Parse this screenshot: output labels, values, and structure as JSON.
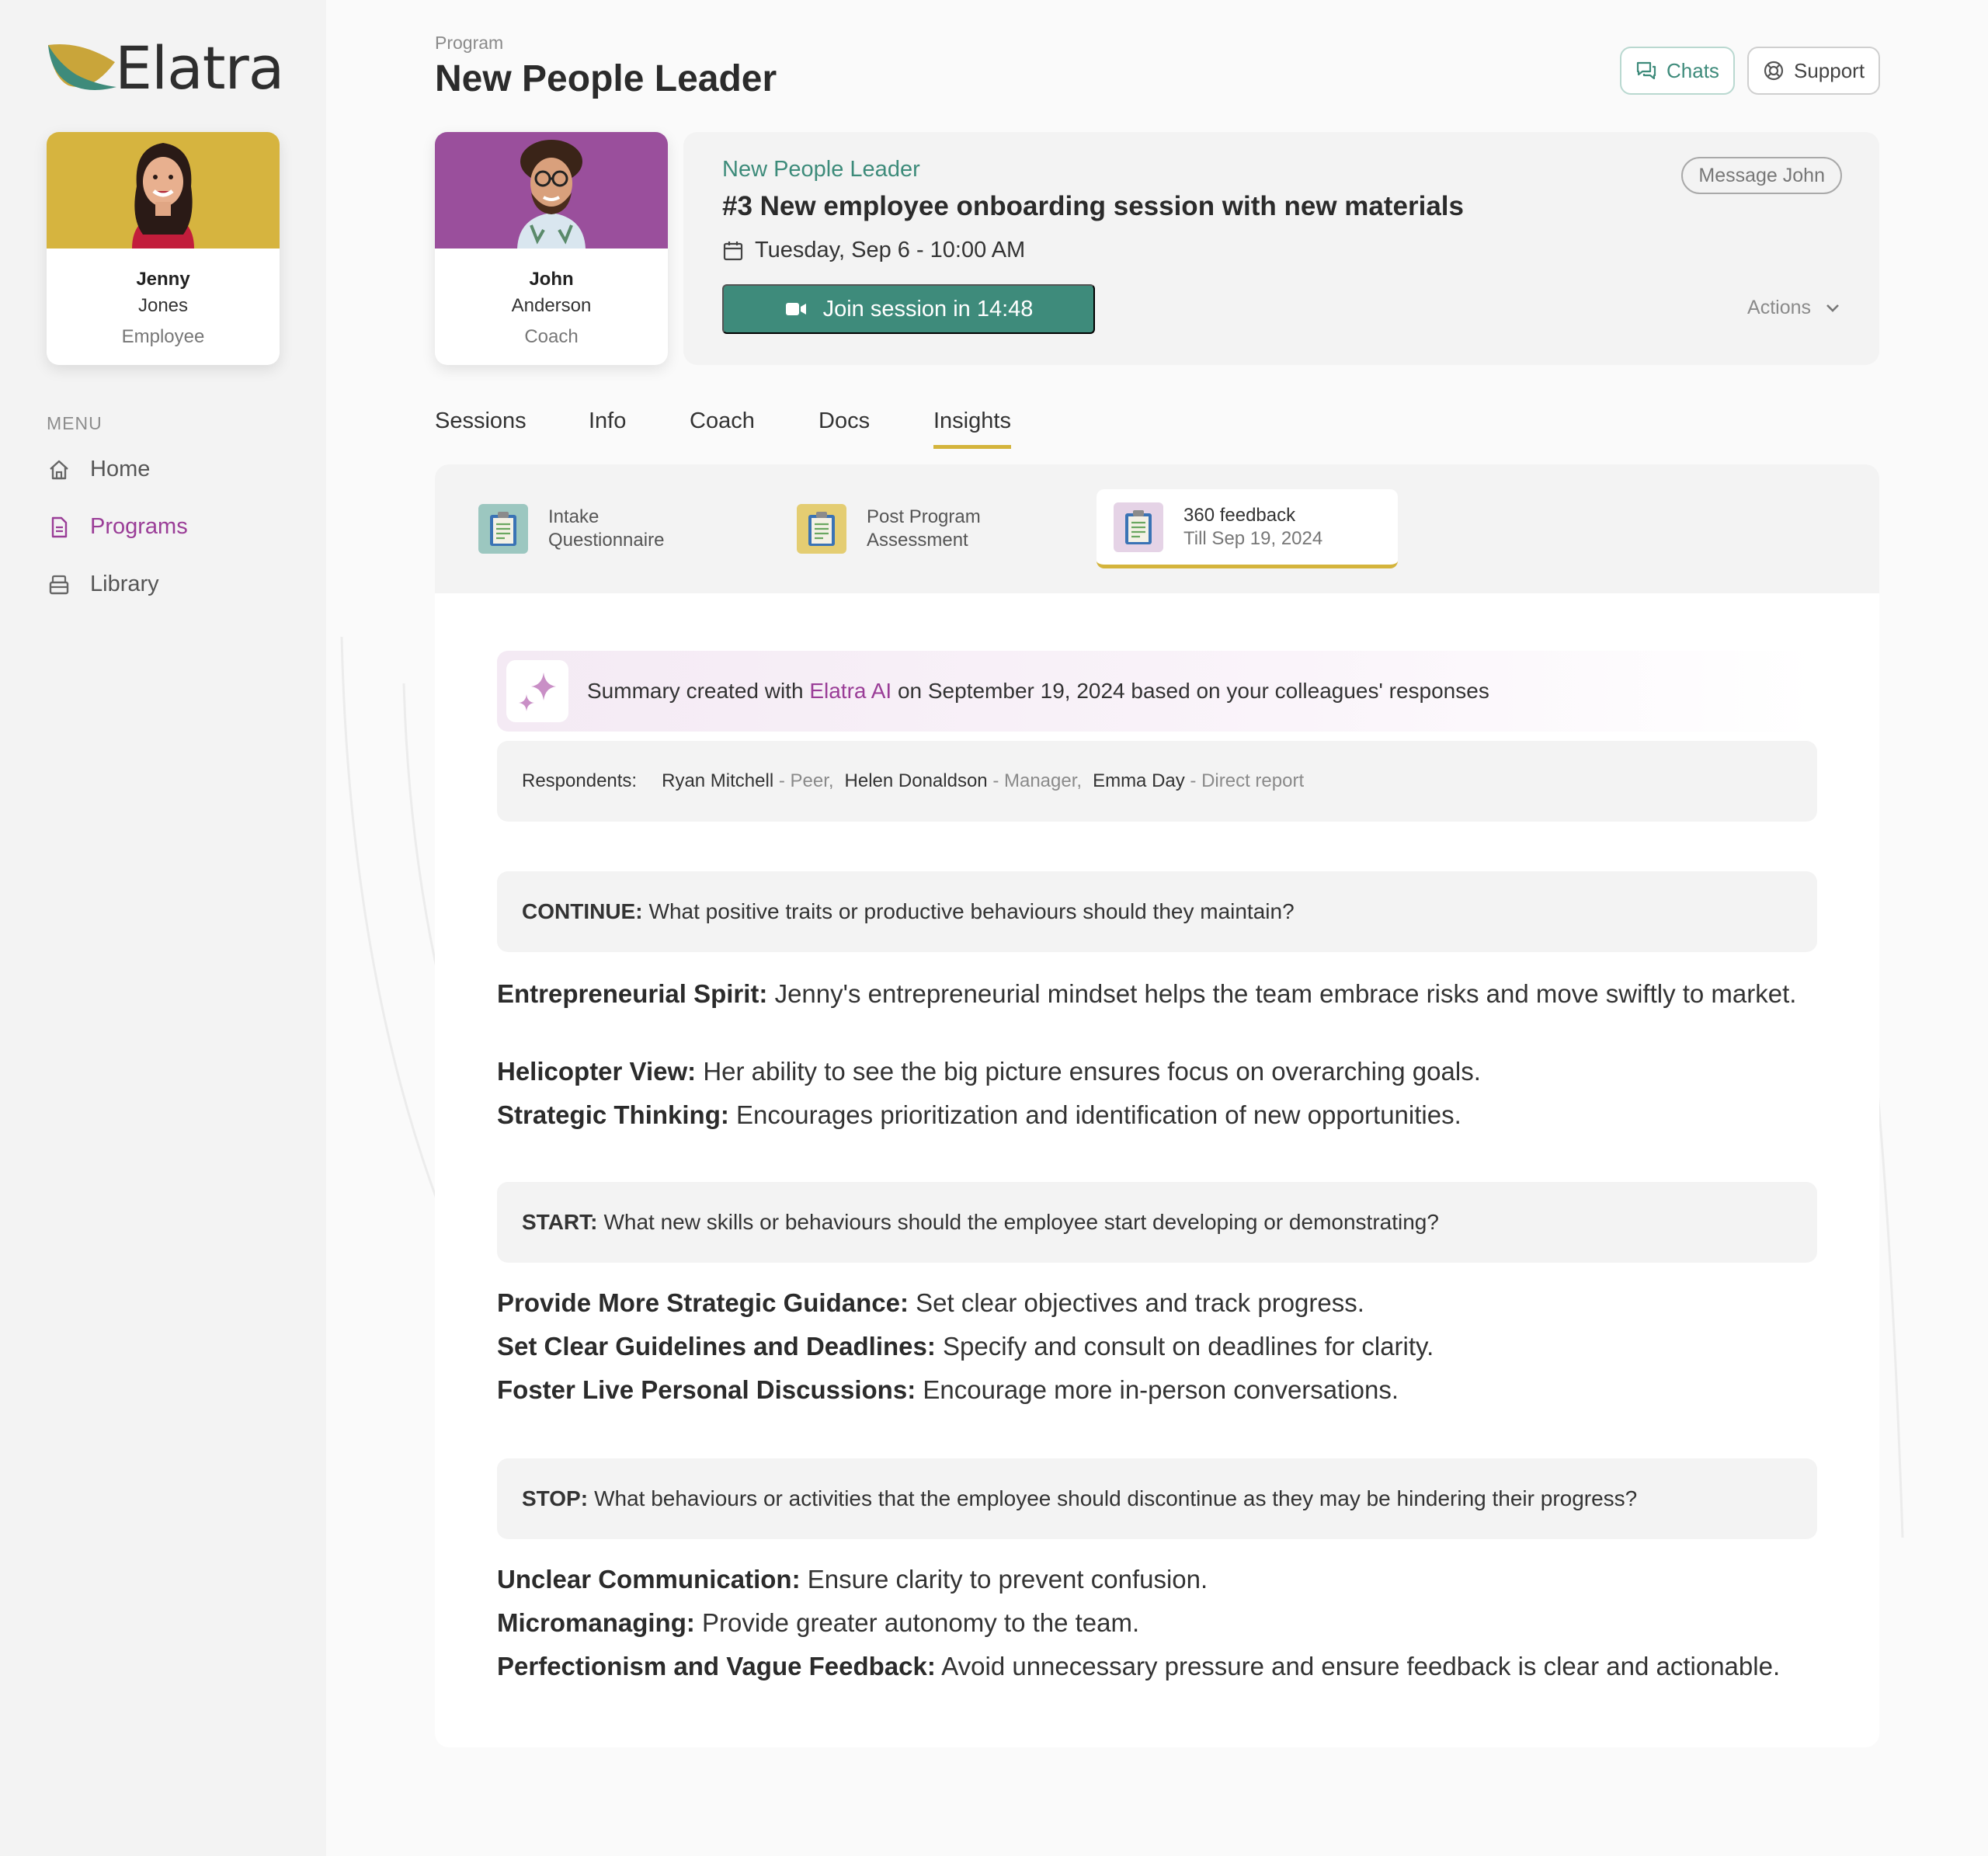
{
  "brand": {
    "name": "Elatra"
  },
  "employee": {
    "first": "Jenny",
    "last": "Jones",
    "role": "Employee"
  },
  "coach": {
    "first": "John",
    "last": "Anderson",
    "role": "Coach"
  },
  "menu": {
    "title": "MENU",
    "items": [
      {
        "label": "Home",
        "icon": "home-icon"
      },
      {
        "label": "Programs",
        "icon": "document-icon",
        "active": true
      },
      {
        "label": "Library",
        "icon": "library-icon"
      }
    ]
  },
  "header": {
    "crumb": "Program",
    "title": "New People Leader",
    "chats": "Chats",
    "support": "Support"
  },
  "session": {
    "program": "New People Leader",
    "title": "#3 New employee onboarding session with new materials",
    "date": "Tuesday, Sep 6 - 10:00 AM",
    "join": "Join session in 14:48",
    "message": "Message John",
    "actions": "Actions"
  },
  "tabs": [
    "Sessions",
    "Info",
    "Coach",
    "Docs",
    "Insights"
  ],
  "subtabs": [
    {
      "line1": "Intake",
      "line2": "Questionnaire"
    },
    {
      "line1": "Post Program",
      "line2": "Assessment"
    },
    {
      "line1": "360 feedback",
      "line2": "Till Sep 19, 2024"
    }
  ],
  "summary": {
    "before": "Summary created with",
    "highlight": "Elatra AI",
    "after": "on September 19, 2024 based on your colleagues' responses"
  },
  "respondents": {
    "label": "Respondents:",
    "list": [
      {
        "name": "Ryan Mitchell",
        "role": "- Peer,"
      },
      {
        "name": "Helen Donaldson",
        "role": "- Manager,"
      },
      {
        "name": "Emma Day",
        "role": "- Direct report"
      }
    ]
  },
  "sections": [
    {
      "key": "CONTINUE:",
      "question": "What positive traits or productive behaviours should they maintain?",
      "items": [
        {
          "title": "Entrepreneurial Spirit:",
          "text": "Jenny's entrepreneurial mindset helps the team embrace risks and move swiftly to market."
        },
        {
          "title": "Helicopter View:",
          "text": "Her ability to see the big picture ensures focus on overarching goals."
        },
        {
          "title": "Strategic Thinking:",
          "text": "Encourages prioritization and identification of new opportunities."
        }
      ]
    },
    {
      "key": "START:",
      "question": "What new skills or behaviours should the employee start developing or demonstrating?",
      "items": [
        {
          "title": "Provide More Strategic Guidance:",
          "text": "Set clear objectives and track progress."
        },
        {
          "title": "Set Clear Guidelines and Deadlines:",
          "text": "Specify and consult on deadlines for clarity."
        },
        {
          "title": "Foster Live Personal Discussions:",
          "text": "Encourage more in-person conversations."
        }
      ]
    },
    {
      "key": "STOP:",
      "question": "What behaviours or activities that the employee should discontinue as they may be hindering their progress?",
      "items": [
        {
          "title": "Unclear Communication:",
          "text": "Ensure clarity to prevent confusion."
        },
        {
          "title": "Micromanaging:",
          "text": "Provide greater autonomy to the team."
        },
        {
          "title": "Perfectionism and Vague Feedback:",
          "text": "Avoid unnecessary pressure and ensure feedback is clear and actionable."
        }
      ]
    }
  ],
  "colors": {
    "accent_green": "#3e8b7b",
    "accent_purple": "#9a3d97",
    "accent_gold": "#d4b43c",
    "employee_bg": "#d6b43f",
    "coach_bg": "#9a4f9c"
  }
}
